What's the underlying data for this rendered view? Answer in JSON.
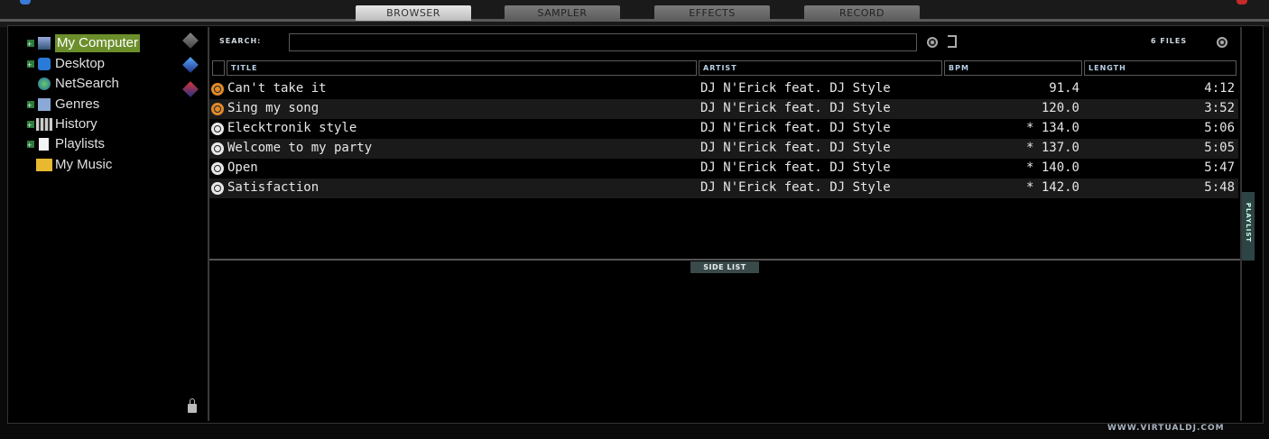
{
  "tabs": [
    {
      "label": "BROWSER",
      "active": true
    },
    {
      "label": "SAMPLER",
      "active": false
    },
    {
      "label": "EFFECTS",
      "active": false
    },
    {
      "label": "RECORD",
      "active": false
    }
  ],
  "sidebar": {
    "items": [
      {
        "label": "My Computer",
        "selected": true,
        "expandable": true,
        "icon": "computer-icon"
      },
      {
        "label": "Desktop",
        "selected": false,
        "expandable": true,
        "icon": "desktop-icon"
      },
      {
        "label": "NetSearch",
        "selected": false,
        "expandable": false,
        "icon": "globe-icon"
      },
      {
        "label": "Genres",
        "selected": false,
        "expandable": true,
        "icon": "genres-icon"
      },
      {
        "label": "History",
        "selected": false,
        "expandable": true,
        "icon": "history-icon"
      },
      {
        "label": "Playlists",
        "selected": false,
        "expandable": true,
        "icon": "playlist-icon"
      },
      {
        "label": "My Music",
        "selected": false,
        "expandable": false,
        "icon": "folder-icon"
      }
    ]
  },
  "search": {
    "label": "SEARCH:",
    "value": ""
  },
  "files_count": "6 FILES",
  "columns": {
    "title": "TITLE",
    "artist": "ARTIST",
    "bpm": "BPM",
    "length": "LENGTH"
  },
  "tracks": [
    {
      "title": "Can't take it",
      "artist": "DJ N'Erick feat. DJ Style",
      "bpm": "91.4",
      "length": "4:12",
      "icon": "orange"
    },
    {
      "title": "Sing my song",
      "artist": "DJ N'Erick feat. DJ Style",
      "bpm": "120.0",
      "length": "3:52",
      "icon": "orange"
    },
    {
      "title": "Elecktronik style",
      "artist": "DJ N'Erick feat. DJ Style",
      "bpm": "* 134.0",
      "length": "5:06",
      "icon": "white"
    },
    {
      "title": "Welcome to my party",
      "artist": "DJ N'Erick feat. DJ Style",
      "bpm": "* 137.0",
      "length": "5:05",
      "icon": "white"
    },
    {
      "title": "Open",
      "artist": "DJ N'Erick feat. DJ Style",
      "bpm": "* 140.0",
      "length": "5:47",
      "icon": "white"
    },
    {
      "title": "Satisfaction",
      "artist": "DJ N'Erick feat. DJ Style",
      "bpm": "* 142.0",
      "length": "5:48",
      "icon": "white"
    }
  ],
  "side_list_label": "SIDE LIST",
  "playlist_tab_label": "PLAYLIST",
  "footer": "WWW.VIRTUALDJ.COM",
  "colors": {
    "selected": "#6c8f2c",
    "accent_tab": "#2e4444"
  }
}
